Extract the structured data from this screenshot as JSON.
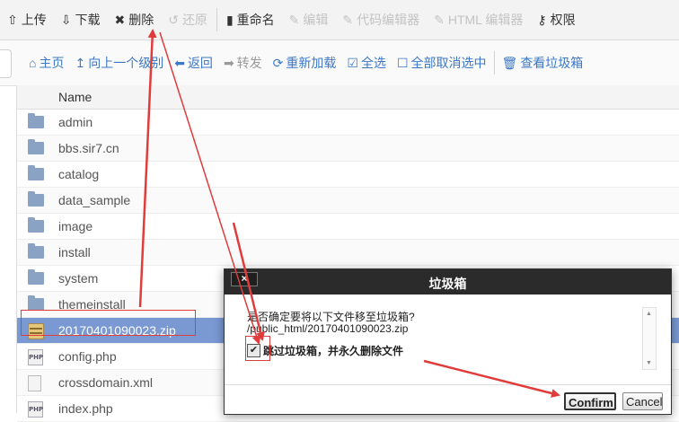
{
  "toolbar": {
    "items": [
      {
        "label": "上传",
        "icon": "upload-icon",
        "enabled": true
      },
      {
        "label": "下载",
        "icon": "download-icon",
        "enabled": true
      },
      {
        "label": "删除",
        "icon": "delete-icon",
        "enabled": true
      },
      {
        "label": "还原",
        "icon": "restore-icon",
        "enabled": false
      },
      {
        "label": "重命名",
        "icon": "rename-icon",
        "enabled": true
      },
      {
        "label": "编辑",
        "icon": "pencil-icon",
        "enabled": false
      },
      {
        "label": "代码编辑器",
        "icon": "code-editor-icon",
        "enabled": false
      },
      {
        "label": "HTML 编辑器",
        "icon": "html-editor-icon",
        "enabled": false
      },
      {
        "label": "权限",
        "icon": "key-icon",
        "enabled": true
      }
    ]
  },
  "navbar": {
    "items": [
      {
        "label": "主页",
        "icon": "home-icon"
      },
      {
        "label": "向上一个级别",
        "icon": "level-up-icon"
      },
      {
        "label": "返回",
        "icon": "arrow-left-icon"
      },
      {
        "label": "转发",
        "icon": "arrow-right-icon"
      },
      {
        "label": "重新加载",
        "icon": "refresh-icon"
      },
      {
        "label": "全选",
        "icon": "check-square-icon"
      },
      {
        "label": "全部取消选中",
        "icon": "square-icon"
      },
      {
        "label": "查看垃圾箱",
        "icon": "trash-icon"
      }
    ]
  },
  "file_list": {
    "header_name": "Name",
    "rows": [
      {
        "name": "admin",
        "type": "folder"
      },
      {
        "name": "bbs.sir7.cn",
        "type": "folder"
      },
      {
        "name": "catalog",
        "type": "folder"
      },
      {
        "name": "data_sample",
        "type": "folder"
      },
      {
        "name": "image",
        "type": "folder"
      },
      {
        "name": "install",
        "type": "folder"
      },
      {
        "name": "system",
        "type": "folder"
      },
      {
        "name": "themeinstall",
        "type": "folder"
      },
      {
        "name": "20170401090023.zip",
        "type": "zip",
        "selected": true
      },
      {
        "name": "config.php",
        "type": "php"
      },
      {
        "name": "crossdomain.xml",
        "type": "xml"
      },
      {
        "name": "index.php",
        "type": "php"
      }
    ]
  },
  "dialog": {
    "title": "垃圾箱",
    "close_label": "×",
    "message": "是否确定要将以下文件移至垃圾箱?",
    "file_path": "/public_html/20170401090023.zip",
    "skip_label": "跳过垃圾箱，并永久删除文件",
    "skip_checked": true,
    "checkbox_mark": "✔",
    "confirm_label": "Confirm",
    "cancel_label": "Cancel",
    "scroll_up": "▲",
    "scroll_down": "▼"
  },
  "colors": {
    "accent_blue": "#3c78c8",
    "selected_row": "#7a98d2",
    "annotation_red": "#e03c3c",
    "dialog_title_bg": "#2b2b2b"
  }
}
